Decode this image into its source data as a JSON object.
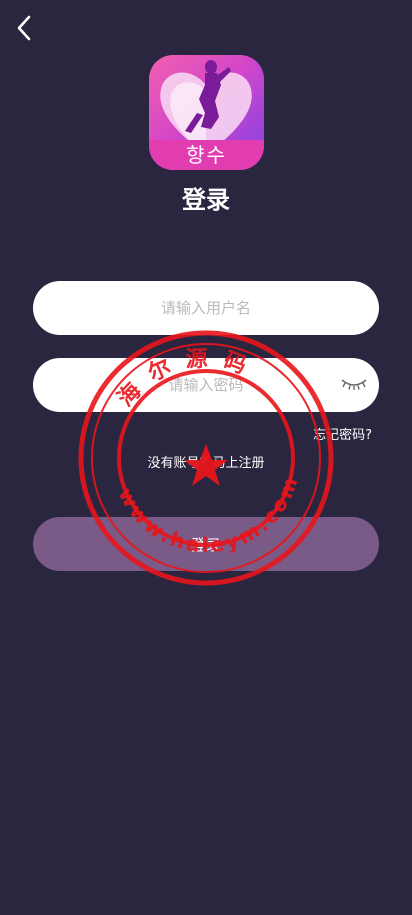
{
  "app": {
    "logo_text": "향수",
    "title": "登录"
  },
  "form": {
    "username_placeholder": "请输入用户名",
    "password_placeholder": "请输入密码",
    "forgot_label": "忘记密码?",
    "register_label": "没有账号？马上注册",
    "login_label": "登录"
  },
  "watermark": {
    "top_text": "海尔源码",
    "bottom_text": "www.haleym.com"
  },
  "colors": {
    "background": "#2a2640",
    "button": "#7a5a86",
    "stamp": "#e8151b"
  },
  "icons": {
    "back": "chevron-left-icon",
    "eye": "eye-closed-icon"
  }
}
